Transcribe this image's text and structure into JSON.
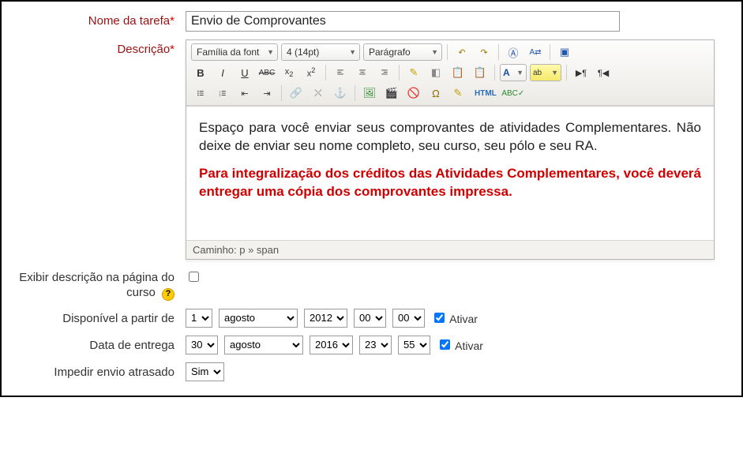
{
  "labels": {
    "taskName": "Nome da tarefa",
    "description": "Descrição",
    "showDesc": "Exibir descrição na página do curso",
    "availableFrom": "Disponível a partir de",
    "dueDate": "Data de entrega",
    "preventLate": "Impedir envio atrasado",
    "activate": "Ativar"
  },
  "taskName": "Envio de Comprovantes",
  "editor": {
    "fontFamily": "Família da font",
    "fontSize": "4 (14pt)",
    "blockFormat": "Parágrafo",
    "path": "Caminho: p » span",
    "content": {
      "p1": "Espaço para você enviar seus comprovantes de atividades Complementares. Não deixe de enviar seu nome completo, seu curso, seu pólo e seu RA.",
      "p2": "Para integralização dos créditos das Atividades Complementares, você deverá entregar uma cópia dos comprovantes impressa."
    },
    "buttons": {
      "undo": "↶",
      "redo": "↷",
      "find": "🔍",
      "replace": "⇄",
      "fullscreen": "⛶",
      "bold": "B",
      "italic": "I",
      "underline": "U",
      "strike": "ABC",
      "sub": "x₂",
      "sup": "x²",
      "alignL": "≡",
      "alignC": "≡",
      "alignR": "≡",
      "alignJ": "≡",
      "clean": "✎",
      "erase": "◧",
      "pasteText": "📋",
      "pasteWord": "📋",
      "color": "A",
      "bg": "ab",
      "ltr": "¶▶",
      "rtl": "◀¶",
      "ul": "•",
      "ol": "1.",
      "outdent": "⇤",
      "indent": "⇥",
      "link": "🔗",
      "unlink": "⛌",
      "anchor": "⚓",
      "image": "🖼",
      "media": "🎬",
      "nolink": "🚫",
      "omega": "Ω",
      "edit": "✎",
      "html": "HTML",
      "spell": "✓"
    }
  },
  "showDescChecked": false,
  "availableFrom": {
    "day": "1",
    "month": "agosto",
    "year": "2012",
    "hour": "00",
    "minute": "00",
    "active": true
  },
  "dueDate": {
    "day": "30",
    "month": "agosto",
    "year": "2016",
    "hour": "23",
    "minute": "55",
    "active": true
  },
  "preventLate": "Sim",
  "monthOptions": [
    "agosto"
  ],
  "yearOptions": [
    "2012",
    "2016"
  ]
}
